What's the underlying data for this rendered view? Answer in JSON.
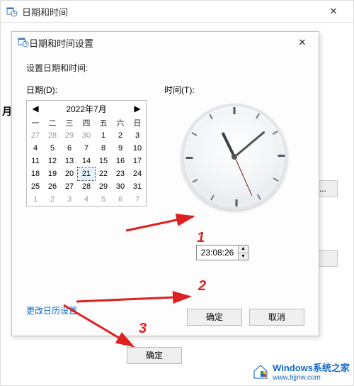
{
  "outer": {
    "title": "日期和时间",
    "close_glyph": "✕",
    "edge_letter": "月",
    "behind_button_1": "D)...",
    "bottom_ok": "确定"
  },
  "inner": {
    "title": "日期和时间设置",
    "close_glyph": "✕",
    "prompt": "设置日期和时间:",
    "date_label": "日期(D):",
    "time_label": "时间(T):",
    "calendar": {
      "month": "2022年7月",
      "prev": "◀",
      "next": "▶",
      "dow": [
        "一",
        "二",
        "三",
        "四",
        "五",
        "六",
        "日"
      ],
      "rows": [
        [
          {
            "d": 27,
            "o": true
          },
          {
            "d": 28,
            "o": true
          },
          {
            "d": 29,
            "o": true
          },
          {
            "d": 30,
            "o": true
          },
          {
            "d": 1
          },
          {
            "d": 2
          },
          {
            "d": 3
          }
        ],
        [
          {
            "d": 4
          },
          {
            "d": 5
          },
          {
            "d": 6
          },
          {
            "d": 7
          },
          {
            "d": 8
          },
          {
            "d": 9
          },
          {
            "d": 10
          }
        ],
        [
          {
            "d": 11
          },
          {
            "d": 12
          },
          {
            "d": 13
          },
          {
            "d": 14
          },
          {
            "d": 15
          },
          {
            "d": 16
          },
          {
            "d": 17
          }
        ],
        [
          {
            "d": 18
          },
          {
            "d": 19
          },
          {
            "d": 20
          },
          {
            "d": 21,
            "sel": true
          },
          {
            "d": 22
          },
          {
            "d": 23
          },
          {
            "d": 24
          }
        ],
        [
          {
            "d": 25
          },
          {
            "d": 26
          },
          {
            "d": 27
          },
          {
            "d": 28
          },
          {
            "d": 29
          },
          {
            "d": 30
          },
          {
            "d": 31
          }
        ],
        [
          {
            "d": 1,
            "o": true
          },
          {
            "d": 2,
            "o": true
          },
          {
            "d": 3,
            "o": true
          },
          {
            "d": 4,
            "o": true
          },
          {
            "d": 5,
            "o": true
          },
          {
            "d": 6,
            "o": true
          },
          {
            "d": 7,
            "o": true
          }
        ]
      ]
    },
    "time_value": "23:08:26",
    "spin_up": "▲",
    "spin_down": "▼",
    "link": "更改日历设置",
    "ok": "确定",
    "cancel": "取消"
  },
  "clock": {
    "hour_angle": 334,
    "minute_angle": 50,
    "second_angle": 156
  },
  "annotations": {
    "n1": "1",
    "n2": "2",
    "n3": "3"
  },
  "watermark": {
    "line1": "Windows系统之家",
    "line2": "www.bjjnw.com"
  }
}
